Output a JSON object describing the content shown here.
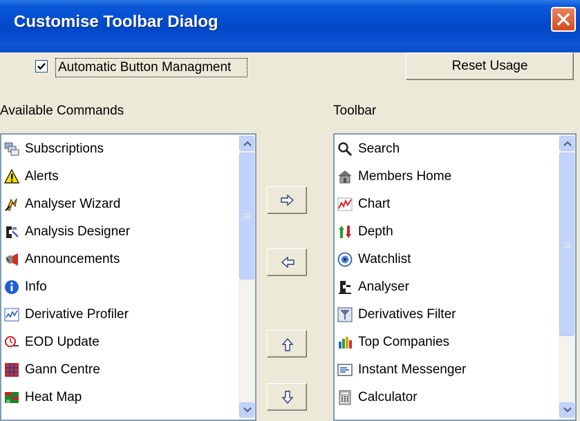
{
  "title": "Customise Toolbar Dialog",
  "automatic": {
    "label": "Automatic Button Managment",
    "checked": true
  },
  "reset_label": "Reset Usage",
  "available_label": "Available Commands",
  "toolbar_label": "Toolbar",
  "available_items": [
    {
      "label": "Subscriptions",
      "icon": "subscriptions-icon"
    },
    {
      "label": "Alerts",
      "icon": "alert-triangle-icon"
    },
    {
      "label": "Analyser Wizard",
      "icon": "analyser-wizard-icon"
    },
    {
      "label": "Analysis Designer",
      "icon": "analysis-designer-icon"
    },
    {
      "label": "Announcements",
      "icon": "announcements-icon"
    },
    {
      "label": "Info",
      "icon": "info-icon"
    },
    {
      "label": "Derivative Profiler",
      "icon": "derivative-profiler-icon"
    },
    {
      "label": "EOD Update",
      "icon": "eod-update-icon"
    },
    {
      "label": "Gann Centre",
      "icon": "gann-centre-icon"
    },
    {
      "label": "Heat Map",
      "icon": "heat-map-icon"
    }
  ],
  "toolbar_items": [
    {
      "label": "Search",
      "icon": "search-icon"
    },
    {
      "label": "Members Home",
      "icon": "members-home-icon"
    },
    {
      "label": "Chart",
      "icon": "chart-icon"
    },
    {
      "label": "Depth",
      "icon": "depth-icon"
    },
    {
      "label": "Watchlist",
      "icon": "watchlist-icon"
    },
    {
      "label": "Analyser",
      "icon": "analyser-icon"
    },
    {
      "label": "Derivatives Filter",
      "icon": "derivatives-filter-icon"
    },
    {
      "label": "Top Companies",
      "icon": "top-companies-icon"
    },
    {
      "label": "Instant Messenger",
      "icon": "instant-messenger-icon"
    },
    {
      "label": "Calculator",
      "icon": "calculator-icon"
    }
  ],
  "colors": {
    "titlebar": "#0047c8",
    "dialog_bg": "#ece9d8",
    "list_border": "#7f9db9",
    "scrollbar": "#c1d3fb"
  }
}
